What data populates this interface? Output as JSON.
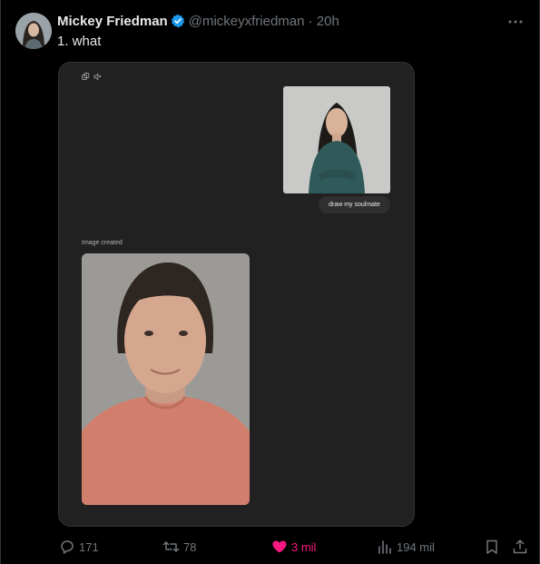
{
  "post": {
    "author": {
      "display_name": "Mickey Friedman",
      "handle": "@mickeyxfriedman · 20h",
      "verified_color": "#1d9bf0",
      "avatar_icon": "avatar-woman"
    },
    "text": "1. what",
    "more_icon": "more-horizontal-icon",
    "media": {
      "prompt": "draw my soulmate",
      "created_label": "Image created",
      "user_photo": "woman-green-sweater",
      "generated_photo": "man-salmon-tshirt"
    },
    "actions": {
      "replies": "171",
      "reposts": "78",
      "likes": "3 mil",
      "views": "194 mil"
    },
    "colors": {
      "like_accent": "#f91880",
      "muted": "#71767b",
      "background": "#000000"
    }
  }
}
